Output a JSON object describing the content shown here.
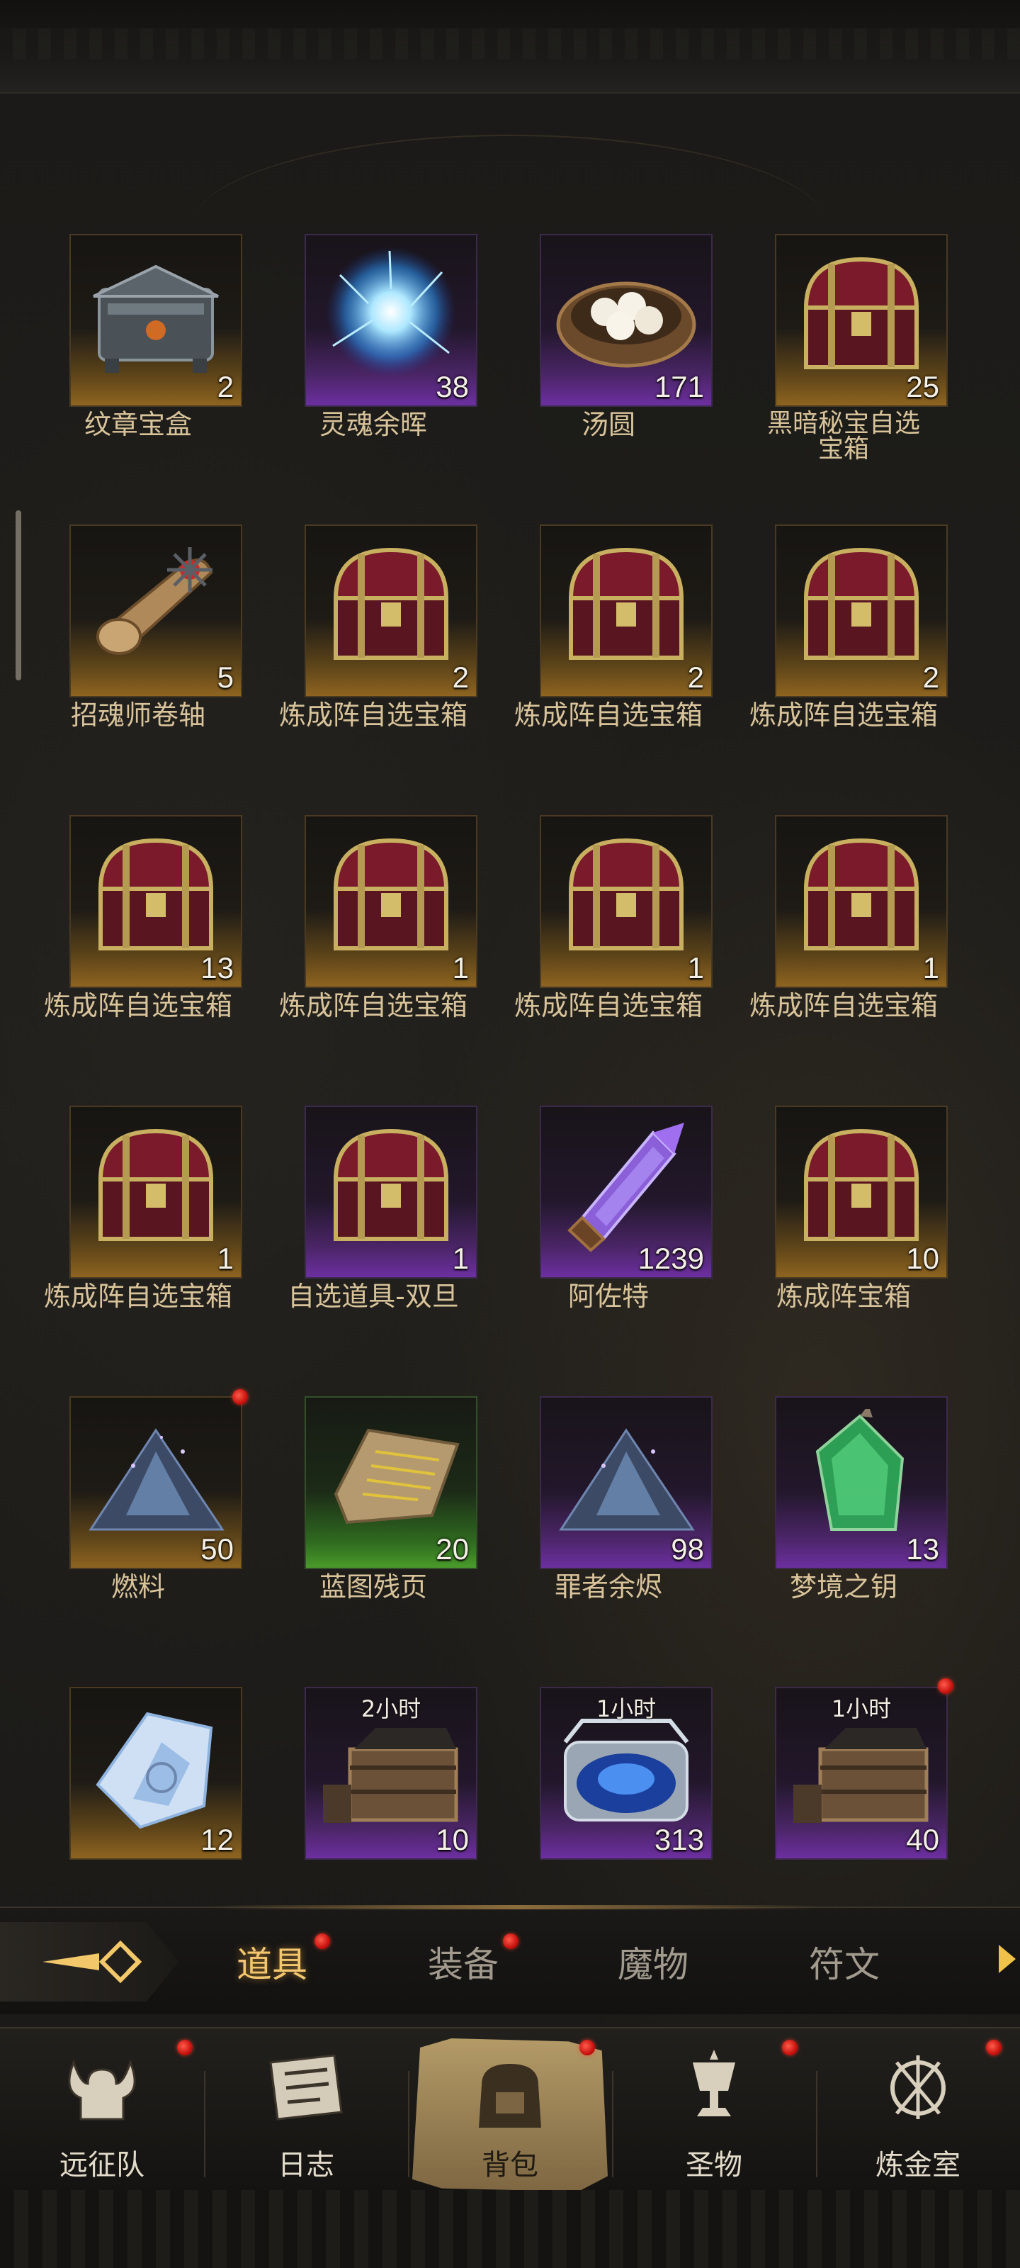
{
  "items": [
    {
      "name": "纹章宝盒",
      "count": "2",
      "rarity": "orange",
      "icon": "crest-chest-icon"
    },
    {
      "name": "灵魂余晖",
      "count": "38",
      "rarity": "purple",
      "icon": "soul-glow-icon"
    },
    {
      "name": "汤圆",
      "count": "171",
      "rarity": "purple",
      "icon": "dumpling-bowl-icon"
    },
    {
      "name": "黑暗秘宝自选宝箱",
      "count": "25",
      "rarity": "orange",
      "icon": "treasure-chest-icon"
    },
    {
      "name": "招魂师卷轴",
      "count": "5",
      "rarity": "orange",
      "icon": "scroll-icon"
    },
    {
      "name": "炼成阵自选宝箱",
      "count": "2",
      "rarity": "orange",
      "icon": "treasure-chest-icon"
    },
    {
      "name": "炼成阵自选宝箱",
      "count": "2",
      "rarity": "orange",
      "icon": "treasure-chest-icon"
    },
    {
      "name": "炼成阵自选宝箱",
      "count": "2",
      "rarity": "orange",
      "icon": "treasure-chest-icon"
    },
    {
      "name": "炼成阵自选宝箱",
      "count": "13",
      "rarity": "orange",
      "icon": "treasure-chest-icon"
    },
    {
      "name": "炼成阵自选宝箱",
      "count": "1",
      "rarity": "orange",
      "icon": "treasure-chest-icon"
    },
    {
      "name": "炼成阵自选宝箱",
      "count": "1",
      "rarity": "orange",
      "icon": "treasure-chest-icon"
    },
    {
      "name": "炼成阵自选宝箱",
      "count": "1",
      "rarity": "orange",
      "icon": "treasure-chest-icon"
    },
    {
      "name": "炼成阵自选宝箱",
      "count": "1",
      "rarity": "orange",
      "icon": "treasure-chest-icon"
    },
    {
      "name": "自选道具-双旦",
      "count": "1",
      "rarity": "purple",
      "icon": "treasure-chest-icon"
    },
    {
      "name": "阿佐特",
      "count": "1239",
      "rarity": "purple",
      "icon": "crystal-vial-icon"
    },
    {
      "name": "炼成阵宝箱",
      "count": "10",
      "rarity": "orange",
      "icon": "treasure-chest-icon"
    },
    {
      "name": "燃料",
      "count": "50",
      "rarity": "orange",
      "icon": "fuel-pile-icon"
    },
    {
      "name": "蓝图残页",
      "count": "20",
      "rarity": "green",
      "icon": "blueprint-page-icon"
    },
    {
      "name": "罪者余烬",
      "count": "98",
      "rarity": "purple",
      "icon": "ember-pile-icon"
    },
    {
      "name": "梦境之钥",
      "count": "13",
      "rarity": "purple",
      "icon": "green-lantern-icon"
    },
    {
      "name": "",
      "count": "12",
      "rarity": "orange",
      "icon": "ice-crystal-icon"
    },
    {
      "name": "",
      "count": "10",
      "rarity": "purple",
      "icon": "crate-icon",
      "timer": "2小时"
    },
    {
      "name": "",
      "count": "313",
      "rarity": "purple",
      "icon": "blue-orb-chest-icon",
      "timer": "1小时"
    },
    {
      "name": "",
      "count": "40",
      "rarity": "purple",
      "icon": "crate-icon",
      "timer": "1小时"
    }
  ],
  "tabs": [
    {
      "label": "道具",
      "active": true
    },
    {
      "label": "装备"
    },
    {
      "label": "魔物"
    },
    {
      "label": "符文"
    }
  ],
  "nav": [
    {
      "label": "远征队",
      "icon": "viking-helmet-icon"
    },
    {
      "label": "日志",
      "icon": "journal-icon"
    },
    {
      "label": "背包",
      "icon": "backpack-icon",
      "active": true
    },
    {
      "label": "圣物",
      "icon": "chalice-icon"
    },
    {
      "label": "炼金室",
      "icon": "alchemy-icon"
    }
  ],
  "colors": {
    "accent": "#f2c66e",
    "badge": "#d81b14",
    "orange_tile": "#8e6420",
    "purple_tile": "#6c2fa0",
    "green_tile": "#4a9b2b"
  }
}
